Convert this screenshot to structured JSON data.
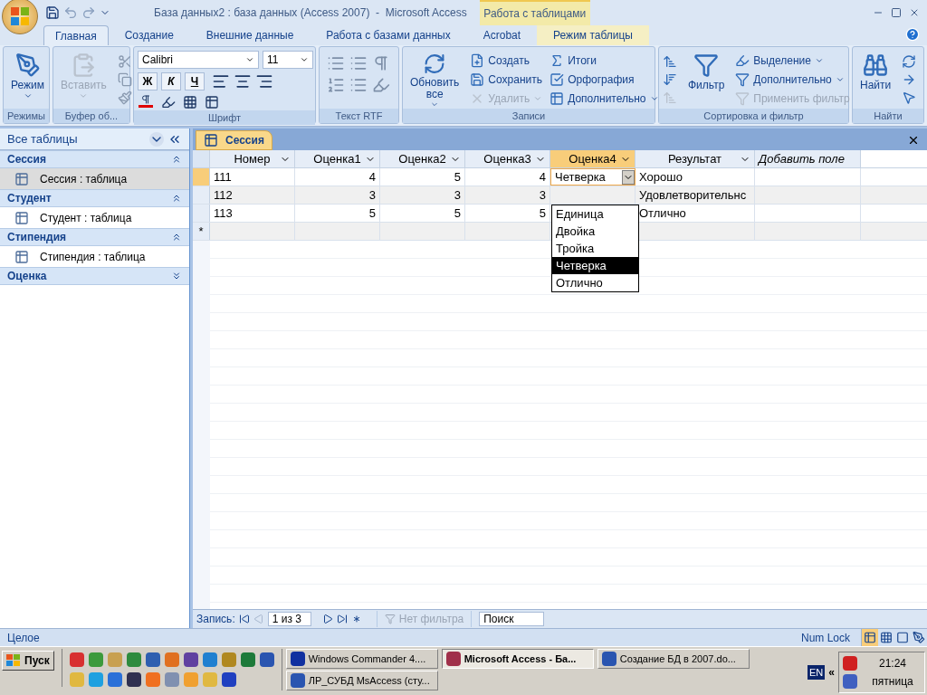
{
  "window": {
    "title": "База данных2 : база данных (Access 2007)  -  Microsoft Access",
    "contextual_tab": "Работа с таблицами"
  },
  "ribbon_tabs": [
    {
      "label": "Главная",
      "selected": true
    },
    {
      "label": "Создание",
      "selected": false
    },
    {
      "label": "Внешние данные",
      "selected": false
    },
    {
      "label": "Работа с базами данных",
      "selected": false
    },
    {
      "label": "Acrobat",
      "selected": false
    },
    {
      "label": "Режим таблицы",
      "selected": false
    }
  ],
  "ribbon_groups": [
    {
      "kind": "modes",
      "label": "Режимы",
      "items": [
        {
          "kind": "large",
          "label": "Режим",
          "disabled": false,
          "menu": true
        }
      ]
    },
    {
      "kind": "clipboard",
      "label": "Буфер об...",
      "items": [
        {
          "kind": "large",
          "label": "Вставить",
          "disabled": true,
          "menu": true
        }
      ]
    },
    {
      "kind": "font",
      "label": "Шрифт",
      "font": "Calibri",
      "size": "11",
      "toggles": [
        {
          "label": "Ж"
        },
        {
          "label": "К"
        },
        {
          "label": "Ч"
        }
      ]
    },
    {
      "kind": "rtf",
      "label": "Текст RTF"
    },
    {
      "kind": "records",
      "label": "Записи",
      "items": [
        {
          "kind": "large",
          "label": "Обновить все",
          "disabled": false,
          "menu": true
        },
        {
          "kind": "small",
          "label": "Создать",
          "disabled": false,
          "menu": false
        },
        {
          "kind": "small",
          "label": "Сохранить",
          "disabled": false,
          "menu": false
        },
        {
          "kind": "small",
          "label": "Удалить",
          "disabled": true,
          "menu": true
        },
        {
          "kind": "small",
          "label": "Итоги",
          "disabled": false,
          "menu": false
        },
        {
          "kind": "small",
          "label": "Орфография",
          "disabled": false,
          "menu": false
        },
        {
          "kind": "small",
          "label": "Дополнительно",
          "disabled": false,
          "menu": true
        }
      ]
    },
    {
      "kind": "sort",
      "label": "Сортировка и фильтр",
      "items": [
        {
          "kind": "large",
          "label": "Фильтр",
          "disabled": false,
          "menu": false
        },
        {
          "kind": "small",
          "label": "Выделение",
          "disabled": false,
          "menu": true
        },
        {
          "kind": "small",
          "label": "Дополнительно",
          "disabled": false,
          "menu": true
        },
        {
          "kind": "small",
          "label": "Применить фильтр",
          "disabled": true,
          "menu": false
        }
      ]
    },
    {
      "kind": "find",
      "label": "Найти",
      "items": [
        {
          "kind": "large",
          "label": "Найти",
          "disabled": false,
          "menu": false
        }
      ]
    }
  ],
  "navigation": {
    "header": "Все таблицы",
    "groups": [
      {
        "title": "Сессия",
        "expanded": true,
        "items": [
          {
            "label": "Сессия : таблица",
            "selected": true
          }
        ]
      },
      {
        "title": "Студент",
        "expanded": true,
        "items": [
          {
            "label": "Студент : таблица",
            "selected": false
          }
        ]
      },
      {
        "title": "Стипендия",
        "expanded": true,
        "items": [
          {
            "label": "Стипендия : таблица",
            "selected": false
          }
        ]
      },
      {
        "title": "Оценка",
        "expanded": false
      }
    ]
  },
  "document_tab": "Сессия",
  "table": {
    "columns": [
      {
        "label": "Номер",
        "selected": false
      },
      {
        "label": "Оценка1",
        "selected": false
      },
      {
        "label": "Оценка2",
        "selected": false
      },
      {
        "label": "Оценка3",
        "selected": false
      },
      {
        "label": "Оценка4",
        "selected": true
      },
      {
        "label": "Результат",
        "selected": false
      }
    ],
    "add_field": "Добавить поле",
    "rows": [
      {
        "selected": true,
        "cells": [
          "111",
          "4",
          "5",
          "4"
        ],
        "result": "Хорошо"
      },
      {
        "selected": false,
        "cells": [
          "112",
          "3",
          "3",
          "3"
        ],
        "result": "Удовлетворительнс"
      },
      {
        "selected": false,
        "cells": [
          "113",
          "5",
          "5",
          "5"
        ],
        "result": "Отлично"
      }
    ],
    "new_row_marker": "*"
  },
  "combo": {
    "value": "Четверка",
    "options": [
      {
        "label": "Единица",
        "selected": false
      },
      {
        "label": "Двойка",
        "selected": false
      },
      {
        "label": "Тройка",
        "selected": false
      },
      {
        "label": "Четверка",
        "selected": true
      },
      {
        "label": "Отлично",
        "selected": false
      }
    ]
  },
  "record_nav": {
    "label": "Запись:",
    "position": "1 из 3",
    "filter": "Нет фильтра",
    "search": "Поиск"
  },
  "status_bar": {
    "left": "Целое",
    "right": "Num Lock"
  },
  "taskbar": {
    "start": "Пуск",
    "tasks": [
      {
        "label": "Windows Commander 4....",
        "selected": false
      },
      {
        "label": "Microsoft Access - Ба...",
        "selected": true
      },
      {
        "label": "Создание БД в 2007.do...",
        "selected": false
      },
      {
        "label": "ЛР_СУБД MsAccess (сту...",
        "selected": false
      }
    ],
    "language": "EN",
    "tray_expand": "«",
    "time": "21:24",
    "day": "пятница"
  }
}
